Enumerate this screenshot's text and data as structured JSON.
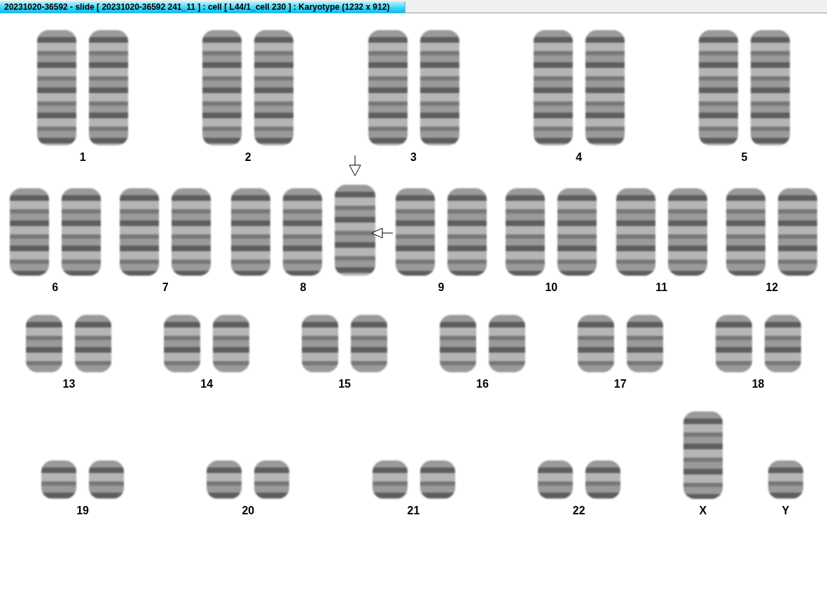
{
  "window": {
    "title": "20231020-36592 - slide [ 20231020-36592 241_11 ] : cell [ L44/1_cell 230 ] : Karyotype  (1232 x 912)"
  },
  "rows": [
    {
      "groups": [
        {
          "label": "1",
          "chromosomes": [
            {
              "kind": "large"
            },
            {
              "kind": "large"
            }
          ]
        },
        {
          "label": "2",
          "chromosomes": [
            {
              "kind": "large"
            },
            {
              "kind": "large"
            }
          ]
        },
        {
          "label": "3",
          "chromosomes": [
            {
              "kind": "large"
            },
            {
              "kind": "large"
            }
          ]
        },
        {
          "label": "4",
          "chromosomes": [
            {
              "kind": "large"
            },
            {
              "kind": "large"
            }
          ]
        },
        {
          "label": "5",
          "chromosomes": [
            {
              "kind": "large"
            },
            {
              "kind": "large"
            }
          ]
        }
      ]
    },
    {
      "groups": [
        {
          "label": "6",
          "chromosomes": [
            {
              "kind": "medium"
            },
            {
              "kind": "medium"
            }
          ]
        },
        {
          "label": "7",
          "chromosomes": [
            {
              "kind": "medium"
            },
            {
              "kind": "medium"
            }
          ]
        },
        {
          "label": "8",
          "chromosomes": [
            {
              "kind": "medium"
            },
            {
              "kind": "medium"
            },
            {
              "kind": "marked"
            }
          ]
        },
        {
          "label": "9",
          "chromosomes": [
            {
              "kind": "medium"
            },
            {
              "kind": "medium"
            }
          ]
        },
        {
          "label": "10",
          "chromosomes": [
            {
              "kind": "medium"
            },
            {
              "kind": "medium"
            }
          ]
        },
        {
          "label": "11",
          "chromosomes": [
            {
              "kind": "medium"
            },
            {
              "kind": "medium"
            }
          ]
        },
        {
          "label": "12",
          "chromosomes": [
            {
              "kind": "medium"
            },
            {
              "kind": "medium"
            }
          ]
        }
      ]
    },
    {
      "groups": [
        {
          "label": "13",
          "chromosomes": [
            {
              "kind": "small"
            },
            {
              "kind": "small"
            }
          ]
        },
        {
          "label": "14",
          "chromosomes": [
            {
              "kind": "small"
            },
            {
              "kind": "small"
            }
          ]
        },
        {
          "label": "15",
          "chromosomes": [
            {
              "kind": "small"
            },
            {
              "kind": "small"
            }
          ]
        },
        {
          "label": "16",
          "chromosomes": [
            {
              "kind": "small"
            },
            {
              "kind": "small"
            }
          ]
        },
        {
          "label": "17",
          "chromosomes": [
            {
              "kind": "small"
            },
            {
              "kind": "small"
            }
          ]
        },
        {
          "label": "18",
          "chromosomes": [
            {
              "kind": "small"
            },
            {
              "kind": "small"
            }
          ]
        }
      ]
    },
    {
      "groups": [
        {
          "label": "19",
          "chromosomes": [
            {
              "kind": "tiny"
            },
            {
              "kind": "tiny"
            }
          ]
        },
        {
          "label": "20",
          "chromosomes": [
            {
              "kind": "tiny"
            },
            {
              "kind": "tiny"
            }
          ]
        },
        {
          "label": "21",
          "chromosomes": [
            {
              "kind": "tiny"
            },
            {
              "kind": "tiny"
            }
          ]
        },
        {
          "label": "22",
          "chromosomes": [
            {
              "kind": "tiny"
            },
            {
              "kind": "tiny"
            }
          ]
        },
        {
          "label": "X",
          "chromosomes": [
            {
              "kind": "medium"
            }
          ]
        },
        {
          "label": "Y",
          "chromosomes": [
            {
              "kind": "tiny"
            }
          ]
        }
      ]
    }
  ]
}
